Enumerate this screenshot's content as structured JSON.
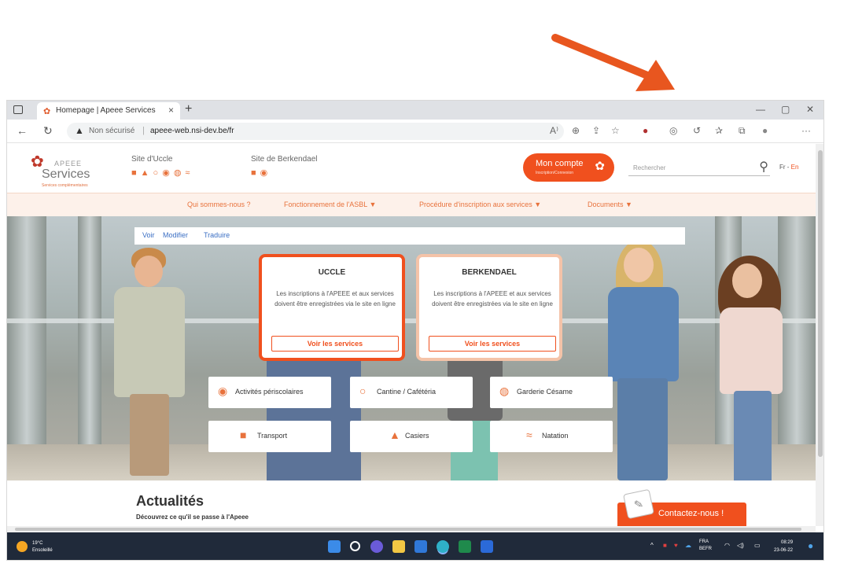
{
  "colors": {
    "accent": "#f0501e",
    "accent_soft": "#e8723c",
    "arrow": "#e8561f",
    "taskbar": "#202a3a"
  },
  "browser": {
    "tab_title": "Homepage | Apeee Services",
    "new_tab": "+",
    "security_label": "Non sécurisé",
    "url": "apeee-web.nsi-dev.be/fr",
    "window_controls": [
      "—",
      "▢",
      "✕"
    ]
  },
  "site": {
    "logo_small": "APEEE",
    "logo_big": "Services",
    "logo_tagline": "Services complémentaires",
    "site_uccle_label": "Site d'Uccle",
    "site_berkendael_label": "Site de Berkendael",
    "account_label": "Mon compte",
    "account_sublabel": "Inscription/Connexion",
    "search_placeholder": "Rechercher",
    "lang_current": "Fr -",
    "lang_alt": "En"
  },
  "nav": {
    "items": [
      "Qui sommes-nous ?",
      "Fonctionnement de l'ASBL ▼",
      "Procédure d'inscription aux services ▼",
      "Documents ▼"
    ]
  },
  "editbar": {
    "items": [
      "Voir",
      "Modifier",
      "Traduire"
    ]
  },
  "cards": [
    {
      "title": "UCCLE",
      "text": "Les inscriptions à l'APEEE et aux services doivent être enregistrées via le site en ligne",
      "button": "Voir les services"
    },
    {
      "title": "BERKENDAEL",
      "text": "Les inscriptions à l'APEEE et aux services doivent être enregistrées via le site en ligne",
      "button": "Voir les services"
    }
  ],
  "services": [
    {
      "label": "Activités périscolaires",
      "icon": "palette-icon"
    },
    {
      "label": "Cantine / Cafétéria",
      "icon": "apple-icon"
    },
    {
      "label": "Garderie Césame",
      "icon": "hand-icon"
    },
    {
      "label": "Transport",
      "icon": "bus-icon"
    },
    {
      "label": "Casiers",
      "icon": "lock-icon"
    },
    {
      "label": "Natation",
      "icon": "swimmer-icon"
    }
  ],
  "news": {
    "title": "Actualités",
    "subtitle": "Découvrez ce qu'il se passe à l'Apeee"
  },
  "contact": {
    "label": "Contactez-nous !"
  },
  "taskbar": {
    "weather_temp": "19°C",
    "weather_desc": "Ensoleillé",
    "lang_top": "FRA",
    "lang_bottom": "BEFR",
    "time": "08:29",
    "date": "23-06-22"
  }
}
